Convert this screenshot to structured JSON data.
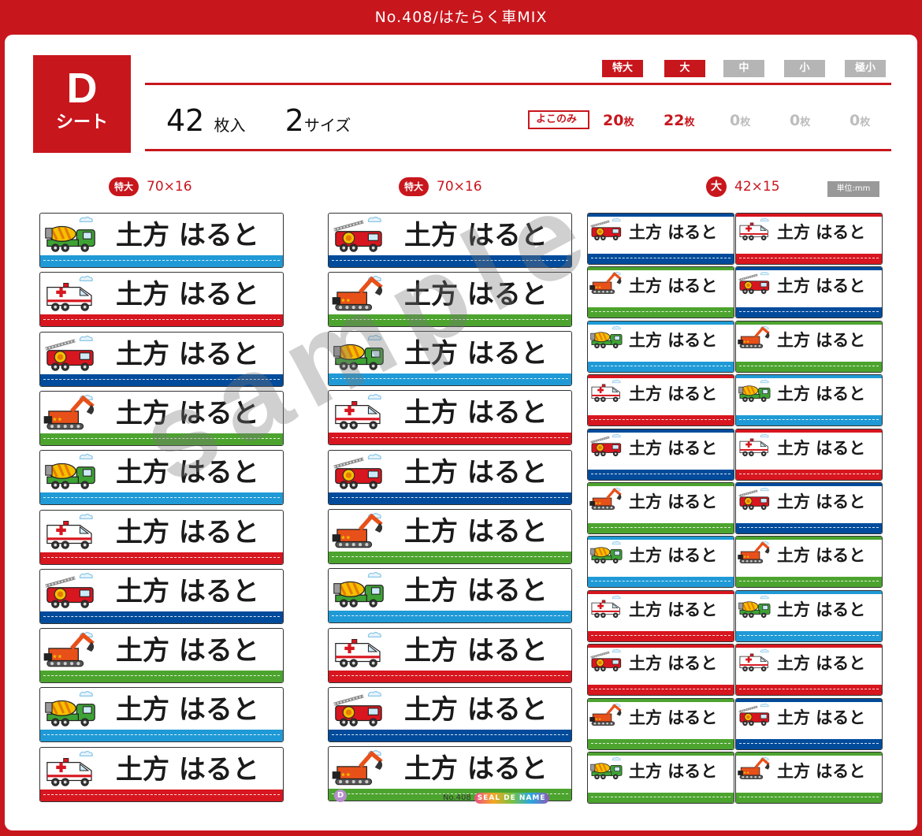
{
  "header": {
    "title": "No.408/はたらく車MIX"
  },
  "sheet": {
    "letter": "D",
    "letter_sub": "シート",
    "count_num": "42",
    "count_unit": "枚入",
    "size_num": "2",
    "size_unit": "サイズ"
  },
  "sizes": [
    {
      "label": "特大",
      "active": true,
      "qty": "20",
      "unit": "枚"
    },
    {
      "label": "大",
      "active": true,
      "qty": "22",
      "unit": "枚"
    },
    {
      "label": "中",
      "active": false,
      "qty": "0",
      "unit": "枚"
    },
    {
      "label": "小",
      "active": false,
      "qty": "0",
      "unit": "枚"
    },
    {
      "label": "極小",
      "active": false,
      "qty": "0",
      "unit": "枚"
    }
  ],
  "yoko_label": "よこのみ",
  "columns": [
    {
      "badge": "特大",
      "dims": "70×16"
    },
    {
      "badge": "特大",
      "dims": "70×16"
    },
    {
      "badge": "大",
      "dims": "42×15"
    }
  ],
  "unit_label": "単位:mm",
  "label_name": "土方 はると",
  "watermark": "sample",
  "footer": {
    "letter": "D",
    "number": "No.408",
    "brand": "SEAL DE NAME"
  },
  "colors": {
    "red": "#d7161f",
    "blue": "#004b9b",
    "green": "#4ca42e",
    "cyan": "#1f9ad6"
  },
  "col1": [
    {
      "vehicle": "mixer-truck",
      "color": "cyan"
    },
    {
      "vehicle": "ambulance",
      "color": "red"
    },
    {
      "vehicle": "fire-truck",
      "color": "blue"
    },
    {
      "vehicle": "excavator",
      "color": "green"
    },
    {
      "vehicle": "mixer-truck",
      "color": "cyan"
    },
    {
      "vehicle": "ambulance",
      "color": "red"
    },
    {
      "vehicle": "fire-truck",
      "color": "blue"
    },
    {
      "vehicle": "excavator",
      "color": "green"
    },
    {
      "vehicle": "mixer-truck",
      "color": "cyan"
    },
    {
      "vehicle": "ambulance",
      "color": "red"
    }
  ],
  "col2": [
    {
      "vehicle": "fire-truck",
      "color": "blue"
    },
    {
      "vehicle": "excavator",
      "color": "green"
    },
    {
      "vehicle": "mixer-truck",
      "color": "cyan"
    },
    {
      "vehicle": "ambulance",
      "color": "red"
    },
    {
      "vehicle": "fire-truck",
      "color": "blue"
    },
    {
      "vehicle": "excavator",
      "color": "green"
    },
    {
      "vehicle": "mixer-truck",
      "color": "cyan"
    },
    {
      "vehicle": "ambulance",
      "color": "red"
    },
    {
      "vehicle": "fire-truck",
      "color": "blue"
    },
    {
      "vehicle": "excavator",
      "color": "green"
    }
  ],
  "col3": [
    {
      "vehicle": "fire-truck",
      "color": "blue"
    },
    {
      "vehicle": "excavator",
      "color": "green"
    },
    {
      "vehicle": "mixer-truck",
      "color": "cyan"
    },
    {
      "vehicle": "ambulance",
      "color": "red"
    },
    {
      "vehicle": "fire-truck",
      "color": "blue"
    },
    {
      "vehicle": "excavator",
      "color": "green"
    },
    {
      "vehicle": "mixer-truck",
      "color": "cyan"
    },
    {
      "vehicle": "ambulance",
      "color": "red"
    },
    {
      "vehicle": "fire-truck",
      "color": "red"
    },
    {
      "vehicle": "excavator",
      "color": "green"
    },
    {
      "vehicle": "mixer-truck",
      "color": "green"
    }
  ],
  "col4": [
    {
      "vehicle": "ambulance",
      "color": "red"
    },
    {
      "vehicle": "fire-truck",
      "color": "blue"
    },
    {
      "vehicle": "excavator",
      "color": "green"
    },
    {
      "vehicle": "mixer-truck",
      "color": "cyan"
    },
    {
      "vehicle": "ambulance",
      "color": "red"
    },
    {
      "vehicle": "fire-truck",
      "color": "blue"
    },
    {
      "vehicle": "excavator",
      "color": "green"
    },
    {
      "vehicle": "mixer-truck",
      "color": "cyan"
    },
    {
      "vehicle": "ambulance",
      "color": "red"
    },
    {
      "vehicle": "fire-truck",
      "color": "blue"
    },
    {
      "vehicle": "excavator",
      "color": "green"
    }
  ]
}
